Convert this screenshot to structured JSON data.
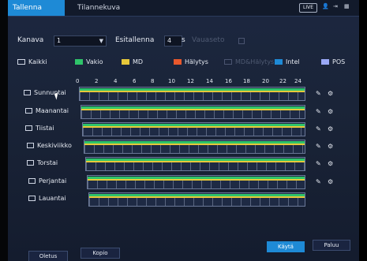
{
  "tabs": [
    {
      "label": "Tallenna"
    },
    {
      "label": "Tilannekuva"
    }
  ],
  "topbar": {
    "live_label": "LIVE",
    "icons": [
      "user-icon",
      "exit-icon",
      "grid-icon"
    ]
  },
  "controls": {
    "channel_label": "Kanava",
    "channel_value": "1",
    "pre_record_label": "Esitallenna",
    "pre_record_value": "4",
    "pre_record_unit": "s",
    "redundancy_label": "Vauaseto"
  },
  "legend": [
    {
      "label": "Kaikki",
      "color": "",
      "style": "outline"
    },
    {
      "label": "Vakio",
      "color": "#2fc46a"
    },
    {
      "label": "MD",
      "color": "#e7c83a"
    },
    {
      "label": "Hälytys",
      "color": "#e8582c"
    },
    {
      "label": "MD&Hälytys",
      "color": "",
      "style": "outline-dim"
    },
    {
      "label": "Intel",
      "color": "#1e8ad6"
    },
    {
      "label": "POS",
      "color": "#9aa8f6"
    }
  ],
  "hours": [
    "0",
    "2",
    "4",
    "6",
    "8",
    "10",
    "12",
    "14",
    "16",
    "18",
    "20",
    "22",
    "24"
  ],
  "days": [
    {
      "label": "Sunnuntai"
    },
    {
      "label": "Maanantai"
    },
    {
      "label": "Tiistai"
    },
    {
      "label": "Keskiviikko"
    },
    {
      "label": "Torstai"
    },
    {
      "label": "Perjantai"
    },
    {
      "label": "Lauantai"
    }
  ],
  "buttons": {
    "default_label": "Oletus",
    "copy_label": "Kopio",
    "apply_label": "Käytä",
    "back_label": "Paluu"
  }
}
